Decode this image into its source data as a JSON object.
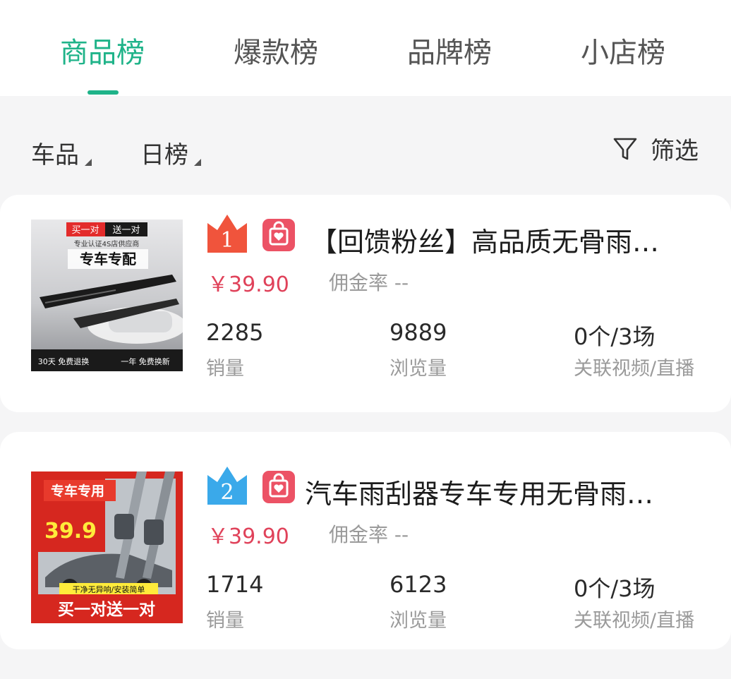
{
  "tabs": [
    {
      "label": "商品榜",
      "active": true
    },
    {
      "label": "爆款榜",
      "active": false
    },
    {
      "label": "品牌榜",
      "active": false
    },
    {
      "label": "小店榜",
      "active": false
    }
  ],
  "filters": {
    "category": "车品",
    "period": "日榜",
    "filter_label": "筛选"
  },
  "colors": {
    "accent": "#1fb389",
    "price": "#e0425a",
    "rank1_crown": "#f0543c",
    "rank2_crown": "#3aa9ea",
    "shop_badge": "#ec5265"
  },
  "products": [
    {
      "rank": "1",
      "crown_color": "#f0543c",
      "title": "【回馈粉丝】高品质无骨雨…",
      "price": "￥39.90",
      "commission": "佣金率 --",
      "sales": "2285",
      "sales_label": "销量",
      "views": "9889",
      "views_label": "浏览量",
      "linked": "0个/3场",
      "linked_label": "关联视频/直播",
      "image": {
        "top_badge_left": "买一对",
        "top_badge_right": "送一对",
        "subtitle": "专业认证4S店供应商",
        "headline": "专车专配",
        "bottom_left": "30天 免费退换",
        "bottom_right": "一年 免费换新"
      }
    },
    {
      "rank": "2",
      "crown_color": "#3aa9ea",
      "title": "汽车雨刮器专车专用无骨雨…",
      "price": "￥39.90",
      "commission": "佣金率 --",
      "sales": "1714",
      "sales_label": "销量",
      "views": "6123",
      "views_label": "浏览量",
      "linked": "0个/3场",
      "linked_label": "关联视频/直播",
      "image": {
        "headline": "专车专用",
        "price_tag": "39.9",
        "strip": "干净无异响/安装简单",
        "bottom": "买一对送一对"
      }
    }
  ]
}
